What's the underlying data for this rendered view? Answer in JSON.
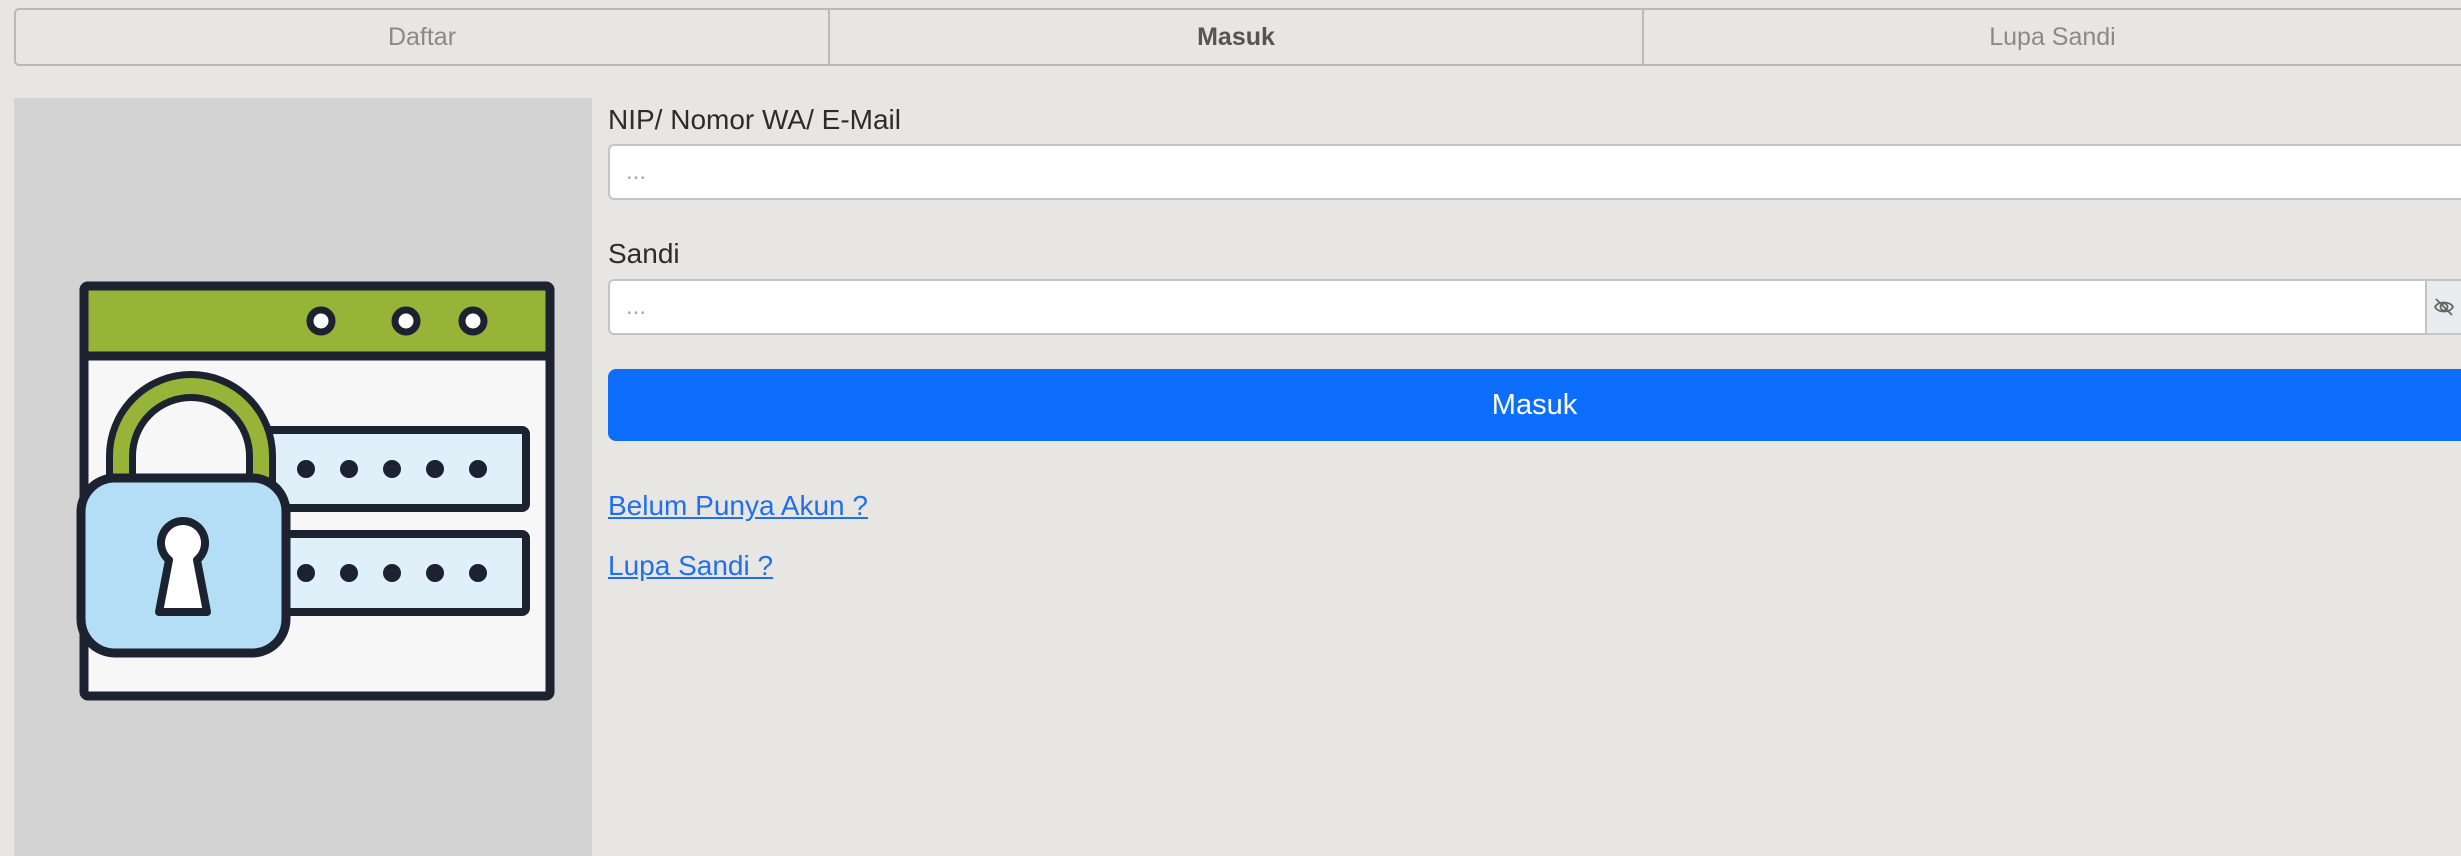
{
  "tabs": [
    {
      "label": "Daftar",
      "active": false
    },
    {
      "label": "Masuk",
      "active": true
    },
    {
      "label": "Lupa Sandi",
      "active": false
    }
  ],
  "form": {
    "id_label": "NIP/ Nomor WA/ E-Mail",
    "id_placeholder": "...",
    "password_label": "Sandi",
    "password_placeholder": "...",
    "submit_label": "Masuk",
    "register_link": "Belum Punya Akun ?",
    "forgot_link": "Lupa Sandi ?"
  },
  "icons": {
    "illustration": "browser-lock-password-icon",
    "password_toggle": "eye-slash-icon"
  },
  "colors": {
    "primary": "#0d6efd",
    "link": "#1f6ff0",
    "illustration_green": "#96b437",
    "illustration_blue": "#b3def5"
  }
}
